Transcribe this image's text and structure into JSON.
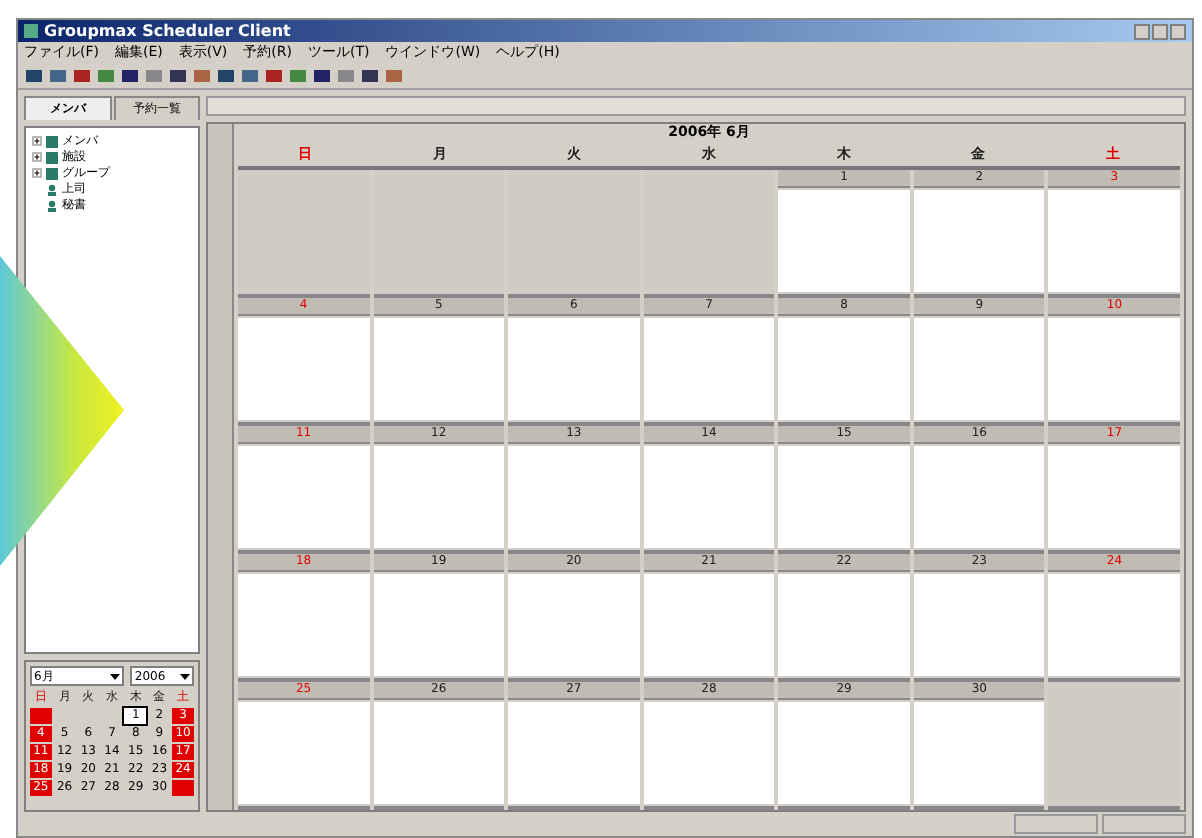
{
  "window": {
    "title": "Groupmax Scheduler Client"
  },
  "menu": [
    "ファイル(F)",
    "編集(E)",
    "表示(V)",
    "予約(R)",
    "ツール(T)",
    "ウインドウ(W)",
    "ヘルプ(H)"
  ],
  "left_tabs": [
    {
      "label": "メンバ",
      "selected": true
    },
    {
      "label": "予約一覧",
      "selected": false
    }
  ],
  "tree": [
    {
      "label": "メンバ",
      "kind": "group"
    },
    {
      "label": "施設",
      "kind": "group"
    },
    {
      "label": "グループ",
      "kind": "group"
    },
    {
      "label": "上司",
      "kind": "leaf"
    },
    {
      "label": "秘書",
      "kind": "leaf"
    }
  ],
  "mini_calendar": {
    "month": "6月",
    "year": "2006",
    "weekdays": [
      {
        "label": "日",
        "holiday": true
      },
      {
        "label": "月",
        "holiday": false
      },
      {
        "label": "火",
        "holiday": false
      },
      {
        "label": "水",
        "holiday": false
      },
      {
        "label": "木",
        "holiday": false
      },
      {
        "label": "金",
        "holiday": false
      },
      {
        "label": "土",
        "holiday": true
      }
    ],
    "weeks": [
      [
        {
          "in_month": false
        },
        {
          "in_month": false
        },
        {
          "in_month": false
        },
        {
          "in_month": false
        },
        {
          "day": "1",
          "selected": true
        },
        {
          "day": "2",
          "selected": false
        },
        {
          "day": "3",
          "selected": false
        }
      ],
      [
        {
          "day": "4",
          "selected": false
        },
        {
          "day": "5",
          "selected": false
        },
        {
          "day": "6",
          "selected": false
        },
        {
          "day": "7",
          "selected": false
        },
        {
          "day": "8",
          "selected": false
        },
        {
          "day": "9",
          "selected": false
        },
        {
          "day": "10",
          "selected": false
        }
      ],
      [
        {
          "day": "11",
          "selected": false
        },
        {
          "day": "12",
          "selected": false
        },
        {
          "day": "13",
          "selected": false
        },
        {
          "day": "14",
          "selected": false
        },
        {
          "day": "15",
          "selected": false
        },
        {
          "day": "16",
          "selected": false
        },
        {
          "day": "17",
          "selected": false
        }
      ],
      [
        {
          "day": "18",
          "selected": false
        },
        {
          "day": "19",
          "selected": false
        },
        {
          "day": "20",
          "selected": false
        },
        {
          "day": "21",
          "selected": false
        },
        {
          "day": "22",
          "selected": false
        },
        {
          "day": "23",
          "selected": false
        },
        {
          "day": "24",
          "selected": false
        }
      ],
      [
        {
          "day": "25",
          "selected": false
        },
        {
          "day": "26",
          "selected": false
        },
        {
          "day": "27",
          "selected": false
        },
        {
          "day": "28",
          "selected": false
        },
        {
          "day": "29",
          "selected": false
        },
        {
          "day": "30",
          "selected": false
        },
        {
          "in_month": false
        }
      ]
    ]
  },
  "calendar": {
    "title": "2006年 6月",
    "weekdays": [
      {
        "label": "日",
        "color": "#e00000"
      },
      {
        "label": "月",
        "color": "#202020"
      },
      {
        "label": "火",
        "color": "#202020"
      },
      {
        "label": "水",
        "color": "#202020"
      },
      {
        "label": "木",
        "color": "#202020"
      },
      {
        "label": "金",
        "color": "#202020"
      },
      {
        "label": "土",
        "color": "#e00000"
      }
    ],
    "weeks": [
      [
        {
          "in_month": false
        },
        {
          "in_month": false
        },
        {
          "in_month": false
        },
        {
          "in_month": false
        },
        {
          "in_month": true,
          "day": "1"
        },
        {
          "in_month": true,
          "day": "2"
        },
        {
          "in_month": true,
          "day": "3"
        }
      ],
      [
        {
          "in_month": true,
          "day": "4"
        },
        {
          "in_month": true,
          "day": "5"
        },
        {
          "in_month": true,
          "day": "6"
        },
        {
          "in_month": true,
          "day": "7"
        },
        {
          "in_month": true,
          "day": "8"
        },
        {
          "in_month": true,
          "day": "9"
        },
        {
          "in_month": true,
          "day": "10"
        }
      ],
      [
        {
          "in_month": true,
          "day": "11"
        },
        {
          "in_month": true,
          "day": "12"
        },
        {
          "in_month": true,
          "day": "13"
        },
        {
          "in_month": true,
          "day": "14"
        },
        {
          "in_month": true,
          "day": "15"
        },
        {
          "in_month": true,
          "day": "16"
        },
        {
          "in_month": true,
          "day": "17"
        }
      ],
      [
        {
          "in_month": true,
          "day": "18"
        },
        {
          "in_month": true,
          "day": "19"
        },
        {
          "in_month": true,
          "day": "20"
        },
        {
          "in_month": true,
          "day": "21"
        },
        {
          "in_month": true,
          "day": "22"
        },
        {
          "in_month": true,
          "day": "23"
        },
        {
          "in_month": true,
          "day": "24"
        }
      ],
      [
        {
          "in_month": true,
          "day": "25"
        },
        {
          "in_month": true,
          "day": "26"
        },
        {
          "in_month": true,
          "day": "27"
        },
        {
          "in_month": true,
          "day": "28"
        },
        {
          "in_month": true,
          "day": "29"
        },
        {
          "in_month": true,
          "day": "30"
        },
        {
          "in_month": false
        }
      ]
    ]
  }
}
